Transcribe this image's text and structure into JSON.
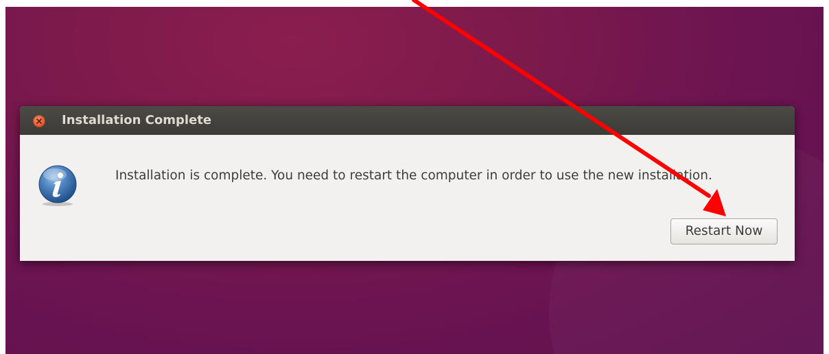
{
  "dialog": {
    "title": "Installation Complete",
    "message": "Installation is complete. You need to restart the computer in order to use the new installation.",
    "restart_label": "Restart Now",
    "close_icon": "close-icon",
    "info_icon": "info-icon"
  },
  "annotation": {
    "arrow_color": "#ff0000"
  },
  "colors": {
    "desktop_bg": "#7a1a4e",
    "titlebar_bg": "#3c3b37",
    "close_button": "#e1552b",
    "dialog_bg": "#f2f1f0"
  }
}
